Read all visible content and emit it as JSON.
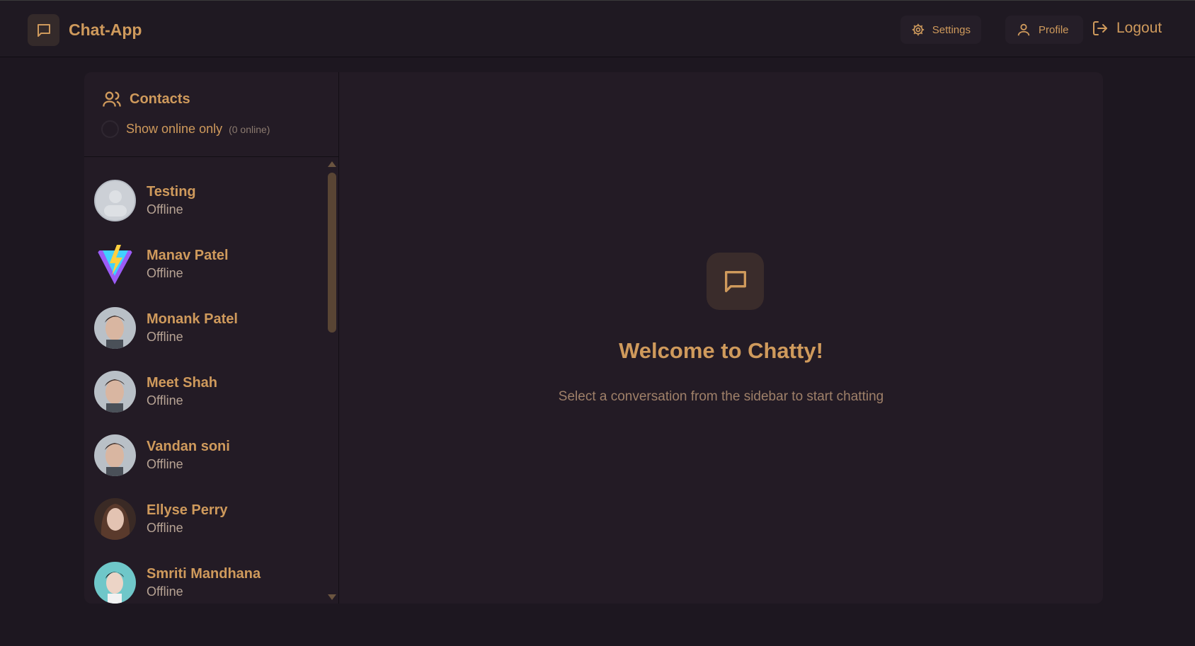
{
  "header": {
    "app_name": "Chat-App",
    "settings_label": "Settings",
    "profile_label": "Profile",
    "logout_label": "Logout"
  },
  "sidebar": {
    "title": "Contacts",
    "filter_label": "Show online only",
    "online_count": "(0 online)",
    "contacts": [
      {
        "name": "Testing",
        "status": "Offline",
        "avatar": "default-avatar-icon"
      },
      {
        "name": "Manav Patel",
        "status": "Offline",
        "avatar": "lightning-logo"
      },
      {
        "name": "Monank Patel",
        "status": "Offline",
        "avatar": "man-photo"
      },
      {
        "name": "Meet Shah",
        "status": "Offline",
        "avatar": "man-photo"
      },
      {
        "name": "Vandan soni",
        "status": "Offline",
        "avatar": "man-photo"
      },
      {
        "name": "Ellyse Perry",
        "status": "Offline",
        "avatar": "woman-photo"
      },
      {
        "name": "Smriti Mandhana",
        "status": "Offline",
        "avatar": "woman-photo-teal"
      }
    ]
  },
  "welcome": {
    "title": "Welcome to Chatty!",
    "subtitle": "Select a conversation from the sidebar to start chatting"
  },
  "colors": {
    "accent": "#cf9a5c",
    "background": "#1d1720",
    "card": "#231b25"
  }
}
